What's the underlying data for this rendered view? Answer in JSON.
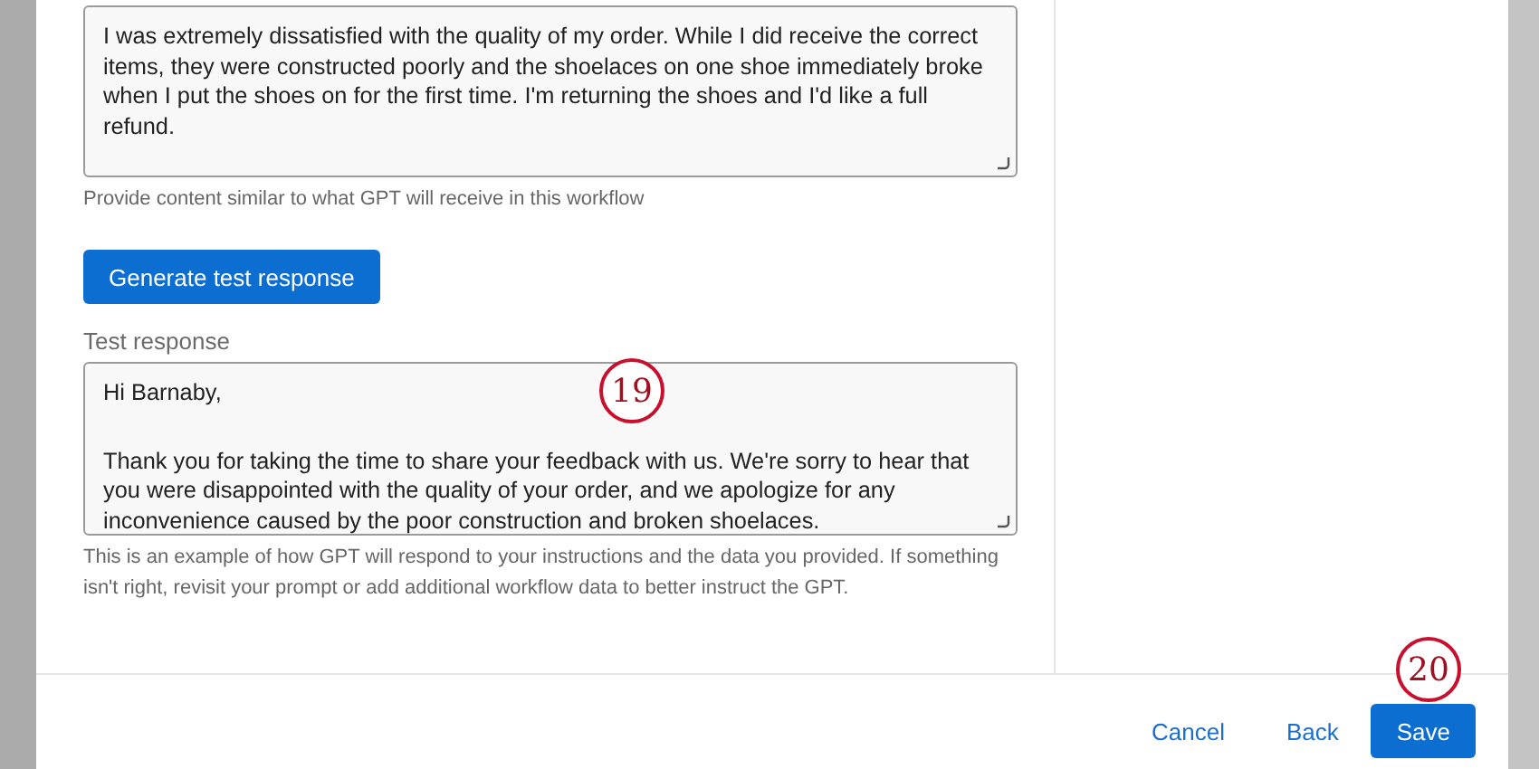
{
  "review_field": {
    "paragraphs": [
      "I was extremely dissatisfied with the quality of my order. While I did receive the correct items, they were constructed poorly and the shoelaces on one shoe immediately broke when I put the shoes on for the first time. I'm returning the shoes and I'd like a full refund."
    ]
  },
  "review_help": "Provide content similar to what GPT will receive in this workflow",
  "generate_button": "Generate test response",
  "response_label": "Test response",
  "response_field": {
    "paragraphs": [
      "Hi Barnaby,",
      "Thank you for taking the time to share your feedback with us. We're sorry to hear that you were disappointed with the quality of your order, and we apologize for any inconvenience caused by the poor construction and broken shoelaces."
    ]
  },
  "response_help": "This is an example of how GPT will respond to your instructions and the data you provided. If something isn't right, revisit your prompt or add additional workflow data to better instruct the GPT.",
  "footer": {
    "buttons": [
      {
        "label": "Cancel",
        "kind": "link"
      },
      {
        "label": "Back",
        "kind": "link"
      },
      {
        "label": "Save",
        "kind": "primary"
      }
    ]
  },
  "callouts": [
    {
      "number": "19"
    },
    {
      "number": "20"
    }
  ]
}
